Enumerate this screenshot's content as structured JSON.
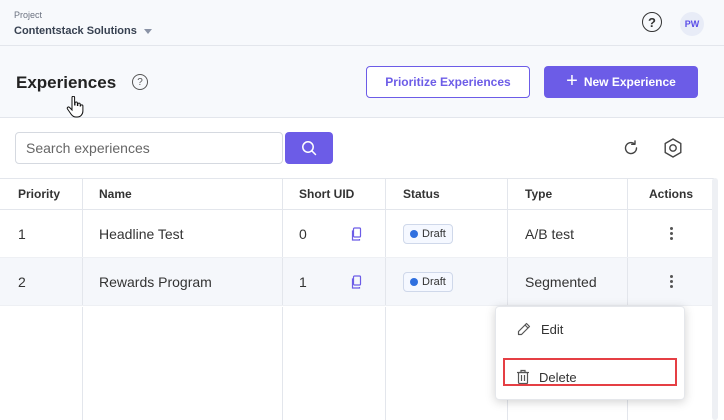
{
  "topbar": {
    "project_label": "Project",
    "project_name": "Contentstack Solutions",
    "avatar_initials": "PW"
  },
  "header": {
    "title": "Experiences",
    "prioritize_label": "Prioritize Experiences",
    "new_label": "New Experience"
  },
  "search": {
    "placeholder": "Search experiences"
  },
  "table": {
    "columns": [
      "Priority",
      "Name",
      "Short UID",
      "Status",
      "Type",
      "Actions"
    ],
    "rows": [
      {
        "priority": "1",
        "name": "Headline Test",
        "uid": "0",
        "status": "Draft",
        "type": "A/B test"
      },
      {
        "priority": "2",
        "name": "Rewards Program",
        "uid": "1",
        "status": "Draft",
        "type": "Segmented"
      }
    ]
  },
  "menu": {
    "edit_label": "Edit",
    "delete_label": "Delete"
  },
  "colors": {
    "accent": "#6c5ce7",
    "status_dot": "#2f6fdf",
    "highlight": "#e53f44"
  }
}
